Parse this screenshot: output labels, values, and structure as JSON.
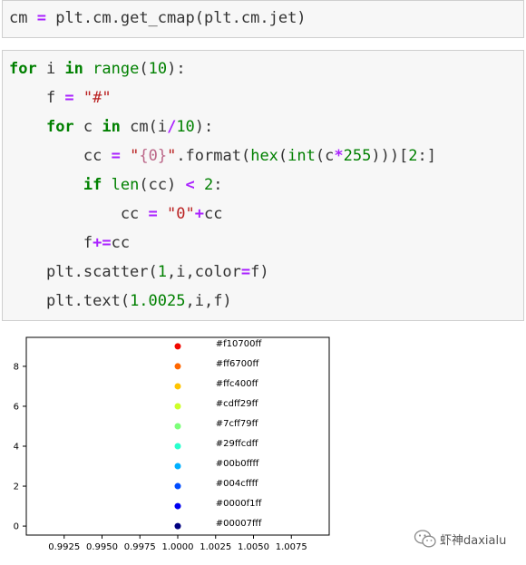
{
  "cells": [
    {
      "lines": [
        [
          [
            "plain",
            "cm "
          ],
          [
            "op",
            "="
          ],
          [
            "plain",
            " plt.cm.get_cmap(plt.cm.jet)"
          ]
        ]
      ]
    },
    {
      "lines": [
        [
          [
            "kw",
            "for"
          ],
          [
            "plain",
            " i "
          ],
          [
            "kw",
            "in"
          ],
          [
            "plain",
            " "
          ],
          [
            "bi",
            "range"
          ],
          [
            "plain",
            "("
          ],
          [
            "num",
            "10"
          ],
          [
            "plain",
            "):"
          ]
        ],
        [
          [
            "plain",
            "    f "
          ],
          [
            "op",
            "="
          ],
          [
            "plain",
            " "
          ],
          [
            "str",
            "\"#\""
          ]
        ],
        [
          [
            "plain",
            "    "
          ],
          [
            "kw",
            "for"
          ],
          [
            "plain",
            " c "
          ],
          [
            "kw",
            "in"
          ],
          [
            "plain",
            " cm(i"
          ],
          [
            "op",
            "/"
          ],
          [
            "num",
            "10"
          ],
          [
            "plain",
            "):"
          ]
        ],
        [
          [
            "plain",
            "        cc "
          ],
          [
            "op",
            "="
          ],
          [
            "plain",
            " "
          ],
          [
            "str",
            "\""
          ],
          [
            "si",
            "{0}"
          ],
          [
            "str",
            "\""
          ],
          [
            "plain",
            ".format("
          ],
          [
            "bi",
            "hex"
          ],
          [
            "plain",
            "("
          ],
          [
            "bi",
            "int"
          ],
          [
            "plain",
            "(c"
          ],
          [
            "op",
            "*"
          ],
          [
            "num",
            "255"
          ],
          [
            "plain",
            ")))["
          ],
          [
            "num",
            "2"
          ],
          [
            "plain",
            ":]"
          ]
        ],
        [
          [
            "plain",
            "        "
          ],
          [
            "kw",
            "if"
          ],
          [
            "plain",
            " "
          ],
          [
            "bi",
            "len"
          ],
          [
            "plain",
            "(cc) "
          ],
          [
            "op",
            "<"
          ],
          [
            "plain",
            " "
          ],
          [
            "num",
            "2"
          ],
          [
            "plain",
            ":"
          ]
        ],
        [
          [
            "plain",
            "            cc "
          ],
          [
            "op",
            "="
          ],
          [
            "plain",
            " "
          ],
          [
            "str",
            "\"0\""
          ],
          [
            "op",
            "+"
          ],
          [
            "plain",
            "cc"
          ]
        ],
        [
          [
            "plain",
            "        f"
          ],
          [
            "op",
            "+="
          ],
          [
            "plain",
            "cc"
          ]
        ],
        [
          [
            "plain",
            "    plt.scatter("
          ],
          [
            "num",
            "1"
          ],
          [
            "plain",
            ",i,color"
          ],
          [
            "op",
            "="
          ],
          [
            "plain",
            "f)"
          ]
        ],
        [
          [
            "plain",
            "    plt.text("
          ],
          [
            "num",
            "1.0025"
          ],
          [
            "plain",
            ",i,f)"
          ]
        ]
      ]
    }
  ],
  "chart_data": {
    "type": "scatter",
    "title": "",
    "xlabel": "",
    "ylabel": "",
    "xlim": [
      0.99,
      1.01
    ],
    "ylim": [
      -0.45,
      9.45
    ],
    "xticks": [
      "0.9925",
      "0.9950",
      "0.9975",
      "1.0000",
      "1.0025",
      "1.0050",
      "1.0075"
    ],
    "xtick_values": [
      0.9925,
      0.995,
      0.9975,
      1.0,
      1.0025,
      1.005,
      1.0075
    ],
    "yticks": [
      "0",
      "2",
      "4",
      "6",
      "8"
    ],
    "ytick_values": [
      0,
      2,
      4,
      6,
      8
    ],
    "grid": false,
    "points": [
      {
        "x": 1.0,
        "y": 0,
        "color": "#00007f",
        "label": "#00007fff"
      },
      {
        "x": 1.0,
        "y": 1,
        "color": "#0000f1",
        "label": "#0000f1ff"
      },
      {
        "x": 1.0,
        "y": 2,
        "color": "#004cff",
        "label": "#004cffff"
      },
      {
        "x": 1.0,
        "y": 3,
        "color": "#00b0ff",
        "label": "#00b0ffff"
      },
      {
        "x": 1.0,
        "y": 4,
        "color": "#29ffcd",
        "label": "#29ffcdff"
      },
      {
        "x": 1.0,
        "y": 5,
        "color": "#7cff79",
        "label": "#7cff79ff"
      },
      {
        "x": 1.0,
        "y": 6,
        "color": "#cdff29",
        "label": "#cdff29ff"
      },
      {
        "x": 1.0,
        "y": 7,
        "color": "#ffc400",
        "label": "#ffc400ff"
      },
      {
        "x": 1.0,
        "y": 8,
        "color": "#ff6700",
        "label": "#ff6700ff"
      },
      {
        "x": 1.0,
        "y": 9,
        "color": "#f10700",
        "label": "#f10700ff"
      }
    ],
    "text_offset_x": 0.0025
  },
  "watermark": {
    "text": "虾神daxialu",
    "icon": "wechat-logo-icon"
  }
}
